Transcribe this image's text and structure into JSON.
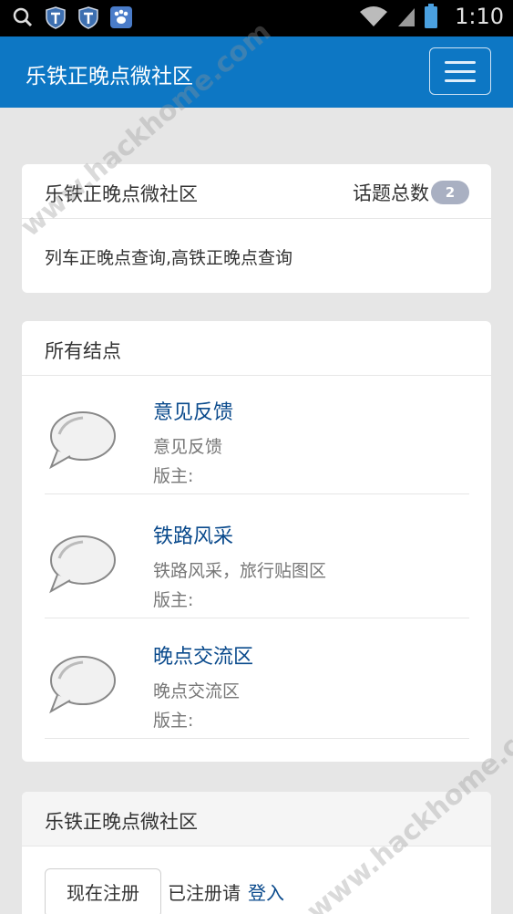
{
  "status_bar": {
    "time": "1:10",
    "icons": [
      "search-icon",
      "shield-icon",
      "shield-icon",
      "paw-icon",
      "wifi-icon",
      "signal-icon",
      "battery-icon"
    ]
  },
  "app_bar": {
    "title": "乐铁正晚点微社区",
    "menu_icon": "hamburger-menu-icon",
    "color": "#0d77c4"
  },
  "community_card": {
    "title": "乐铁正晚点微社区",
    "topic_count_label": "话题总数",
    "topic_count": "2",
    "description": "列车正晚点查询,高铁正晚点查询"
  },
  "nodes_card": {
    "title": "所有结点",
    "nodes": [
      {
        "name": "意见反馈",
        "description": "意见反馈",
        "moderator": "版主:"
      },
      {
        "name": "铁路风采",
        "description": "铁路风采，旅行贴图区",
        "moderator": "版主:"
      },
      {
        "name": "晚点交流区",
        "description": "晚点交流区",
        "moderator": "版主:"
      }
    ]
  },
  "account_card": {
    "title": "乐铁正晚点微社区",
    "register_label": "现在注册",
    "registered_text": "已注册请",
    "login_label": "登入"
  },
  "watermark": "www.hackhome.com"
}
